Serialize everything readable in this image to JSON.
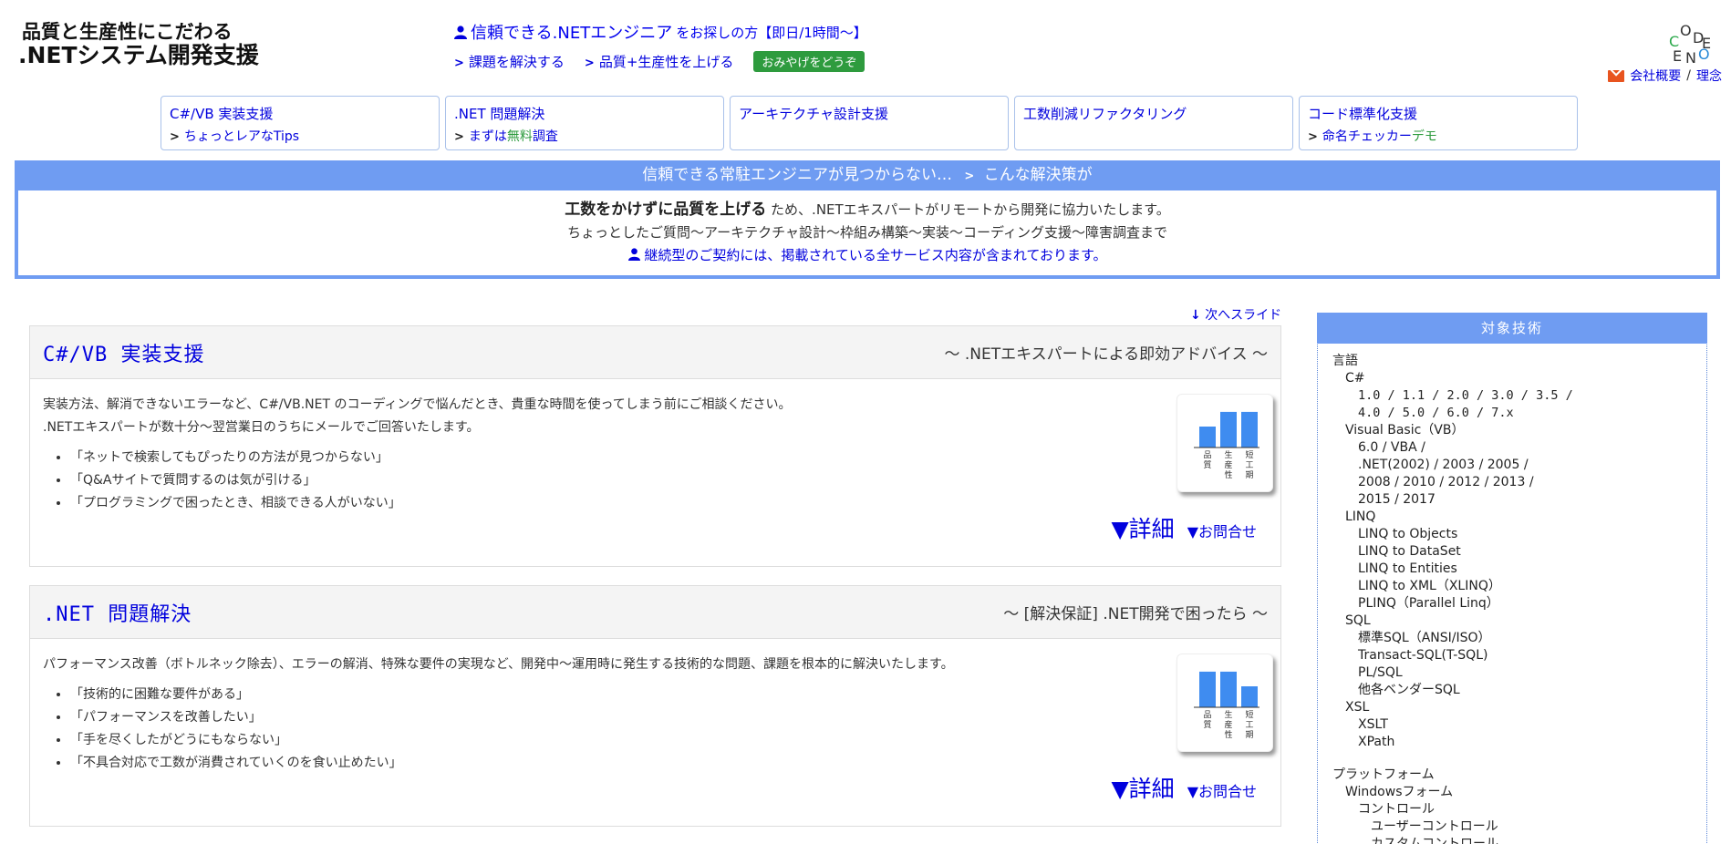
{
  "header": {
    "title_line1": "品質と生産性にこだわる",
    "title_line2": ".NETシステム開発支援",
    "promo_main": "信頼できる.NETエンジニア",
    "promo_main_suffix": "をお探しの方【即日/1時間〜】",
    "promo_link1": "課題を解決する",
    "promo_link2": "品質+生産性を上げる",
    "promo_badge": "おみやげをどうぞ",
    "logo_letters": [
      "O",
      "D",
      "C",
      "E",
      "E",
      "N",
      "O"
    ],
    "corp_links": [
      "会社概要",
      "/",
      "理念"
    ]
  },
  "nav": [
    {
      "title": "C#/VB 実装支援",
      "sub": "ちょっとレアなTips",
      "sub_green": ""
    },
    {
      "title": ".NET 問題解決",
      "sub": "まずは",
      "sub_green": "無料",
      "sub_after": "調査"
    },
    {
      "title": "アーキテクチャ設計支援",
      "sub": "",
      "sub_green": ""
    },
    {
      "title": "工数削減リファクタリング",
      "sub": "",
      "sub_green": ""
    },
    {
      "title": "コード標準化支援",
      "sub": "命名チェッカー",
      "sub_green": "デモ"
    }
  ],
  "banner": {
    "head": "信頼できる常駐エンジニアが見つからない…",
    "head_after": "こんな解決策が",
    "strong": "工数をかけずに品質を上げる",
    "line1_rest": "ため、.NETエキスパートがリモートから開発に協力いたします。",
    "line2": "ちょっとしたご質問〜アーキテクチャ設計〜枠組み構築〜実装〜コーディング支援〜障害調査まで",
    "line3": "継続型のご契約には、掲載されている全サービス内容が含まれております。"
  },
  "next_slide": "次へスライド",
  "cards": [
    {
      "title": "C#/VB 実装支援",
      "sub": "〜 .NETエキスパートによる即効アドバイス 〜",
      "p1": "実装方法、解消できないエラーなど、C#/VB.NET のコーディングで悩んだとき、貴重な時間を使ってしまう前にご相談ください。",
      "p2": ".NETエキスパートが数十分〜翌営業日のうちにメールでご回答いたします。",
      "bullets": [
        "「ネットで検索してもぴったりの方法が見つからない」",
        "「Q&Aサイトで質問するのは気が引ける」",
        "「プログラミングで困ったとき、相談できる人がいない」"
      ],
      "meter": [
        0.5,
        0.85,
        0.85
      ],
      "detail": "▼詳細",
      "inquiry": "▼お問合せ"
    },
    {
      "title": ".NET 問題解決",
      "sub": "〜 [解決保証] .NET開発で困ったら 〜",
      "p1": "パフォーマンス改善（ボトルネック除去）、エラーの解消、特殊な要件の実現など、開発中〜運用時に発生する技術的な問題、課題を根本的に解決いたします。",
      "p2": "",
      "bullets": [
        "「技術的に困難な要件がある」",
        "「パフォーマンスを改善したい」",
        "「手を尽くしたがどうにもならない」",
        "「不具合対応で工数が消費されていくのを食い止めたい」"
      ],
      "meter": [
        0.85,
        0.85,
        0.5
      ],
      "detail": "▼詳細",
      "inquiry": "▼お問合せ"
    }
  ],
  "meter_labels": [
    "品質",
    "生産性",
    "短工期"
  ],
  "side": {
    "title": "対象技術",
    "items": [
      {
        "t": "言語",
        "lv": 0
      },
      {
        "t": "C#",
        "lv": 1
      },
      {
        "t": "1.0 / 1.1 / 2.0 / 3.0 / 3.5 /",
        "lv": 2,
        "mono": true
      },
      {
        "t": "4.0 / 5.0 / 6.0 / 7.x",
        "lv": 2,
        "mono": true
      },
      {
        "t": "Visual Basic（VB）",
        "lv": 1
      },
      {
        "t": "6.0 / VBA /",
        "lv": 2
      },
      {
        "t": ".NET(2002) / 2003 / 2005 /",
        "lv": 2
      },
      {
        "t": "2008 / 2010 / 2012 / 2013 /",
        "lv": 2
      },
      {
        "t": "2015 / 2017",
        "lv": 2
      },
      {
        "t": "LINQ",
        "lv": 1
      },
      {
        "t": "LINQ to Objects",
        "lv": 2
      },
      {
        "t": "LINQ to DataSet",
        "lv": 2
      },
      {
        "t": "LINQ to Entities",
        "lv": 2
      },
      {
        "t": "LINQ to XML（XLINQ）",
        "lv": 2
      },
      {
        "t": "PLINQ（Parallel Linq）",
        "lv": 2
      },
      {
        "t": "SQL",
        "lv": 1
      },
      {
        "t": "標準SQL（ANSI/ISO）",
        "lv": 2
      },
      {
        "t": "Transact-SQL(T-SQL)",
        "lv": 2
      },
      {
        "t": "PL/SQL",
        "lv": 2
      },
      {
        "t": "他各ベンダーSQL",
        "lv": 2
      },
      {
        "t": "XSL",
        "lv": 1
      },
      {
        "t": "XSLT",
        "lv": 2
      },
      {
        "t": "XPath",
        "lv": 2
      },
      {
        "t": "",
        "lv": -1
      },
      {
        "t": "プラットフォーム",
        "lv": 0
      },
      {
        "t": "Windowsフォーム",
        "lv": 1
      },
      {
        "t": "コントロール",
        "lv": 2
      },
      {
        "t": "ユーザーコントロール",
        "lv": 3
      },
      {
        "t": "カスタムコントロール",
        "lv": 3
      }
    ]
  },
  "colors": {
    "accent": "#6f9cf2",
    "link": "#0000dd",
    "bar": "#3f8cf0",
    "green": "#2e9b3e"
  }
}
